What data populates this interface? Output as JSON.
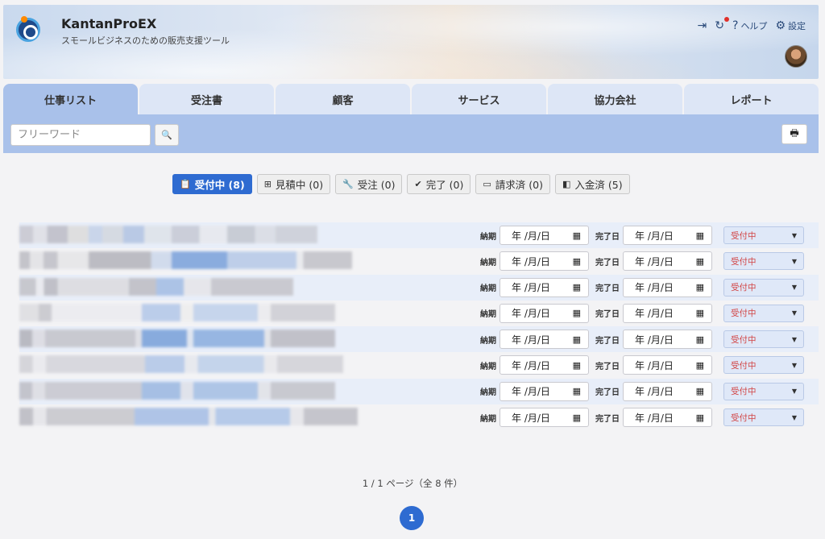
{
  "app": {
    "name": "KantanProEX",
    "tagline": "スモールビジネスのための販売支援ツール"
  },
  "header_tools": {
    "logout_icon": "logout-icon",
    "refresh_icon": "refresh-icon",
    "help_label": "ヘルプ",
    "settings_label": "設定"
  },
  "tabs": [
    {
      "label": "仕事リスト",
      "active": true
    },
    {
      "label": "受注書"
    },
    {
      "label": "顧客"
    },
    {
      "label": "サービス"
    },
    {
      "label": "協力会社"
    },
    {
      "label": "レポート"
    }
  ],
  "search": {
    "placeholder": "フリーワード",
    "button_icon": "🔍"
  },
  "filters": [
    {
      "label": "受付中 (8)",
      "icon": "📋",
      "active": true
    },
    {
      "label": "見積中 (0)",
      "icon": "⊞"
    },
    {
      "label": "受注 (0)",
      "icon": "🔧"
    },
    {
      "label": "完了 (0)",
      "icon": "✔"
    },
    {
      "label": "請求済 (0)",
      "icon": "▭"
    },
    {
      "label": "入金済 (5)",
      "icon": "◧"
    }
  ],
  "row_fields": {
    "due_label": "納期",
    "done_label": "完了日",
    "date_text": "年 /月/日",
    "status_text": "受付中"
  },
  "pagination": {
    "summary": "1 / 1 ページ（全 8 件）",
    "current_page": "1"
  }
}
